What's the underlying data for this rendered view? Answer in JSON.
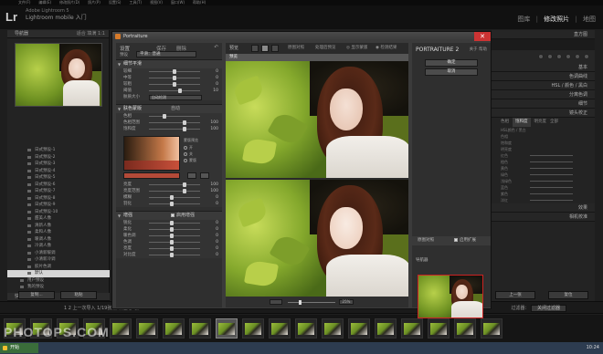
{
  "app": {
    "logo": "Lr",
    "title_small": "Adobe Lightroom 5",
    "title": "Lightroom mobile 入门",
    "menu": [
      "文件(F)",
      "编辑(E)",
      "修改照片(D)",
      "照片(P)",
      "设置(S)",
      "工具(T)",
      "视图(V)",
      "窗口(W)",
      "帮助(H)"
    ],
    "modules": [
      {
        "label": "图库",
        "active": false
      },
      {
        "label": "修改照片",
        "active": true
      },
      {
        "label": "地图",
        "active": false
      }
    ]
  },
  "left_panel": {
    "navigator_label": "导航器",
    "navigator_options": "适合  填满  1:1",
    "presets": [
      {
        "label": "日式预设-1"
      },
      {
        "label": "日式预设-2"
      },
      {
        "label": "日式预设-3"
      },
      {
        "label": "日式预设-4"
      },
      {
        "label": "日式预设-5"
      },
      {
        "label": "日式预设-6"
      },
      {
        "label": "日式预设-7"
      },
      {
        "label": "日式预设-8"
      },
      {
        "label": "日式预设-9"
      },
      {
        "label": "日式预设-10"
      },
      {
        "label": "甜美人像"
      },
      {
        "label": "清新人像"
      },
      {
        "label": "柔和人像"
      },
      {
        "label": "暖调人像"
      },
      {
        "label": "冷调人像"
      },
      {
        "label": "小清新暖调"
      },
      {
        "label": "小清新冷调"
      },
      {
        "label": "胶片色调"
      },
      {
        "label": "默认",
        "selected": true
      },
      {
        "label": "用户预设",
        "folder": true
      },
      {
        "label": "我的预设",
        "folder": true
      }
    ],
    "snapshots_label": "快照",
    "copy_button": "复制...",
    "paste_button": "粘贴"
  },
  "portraiture": {
    "window_title": "Portraiture",
    "close_glyph": "✕",
    "top": {
      "settings": "设置",
      "save": "保存",
      "delete": "删除",
      "undo": "↶",
      "preset_label": "预设",
      "preset_value": "平滑：普通"
    },
    "smoothing": {
      "header": "细节平滑",
      "sliders": [
        {
          "label": "较细",
          "value": "0",
          "knob_pct": 50
        },
        {
          "label": "中等",
          "value": "0",
          "knob_pct": 50
        },
        {
          "label": "较粗",
          "value": "0",
          "knob_pct": 50
        },
        {
          "label": "阈值",
          "value": "10",
          "knob_pct": 60
        }
      ],
      "size_label": "肤质大小",
      "size_value": "自动检测"
    },
    "mask": {
      "header": "肤色蒙版",
      "mode": "自动",
      "sliders": [
        {
          "label": "色相",
          "value": "",
          "knob_pct": 30
        },
        {
          "label": "色相范围",
          "value": "100",
          "knob_pct": 70
        },
        {
          "label": "饱和度",
          "value": "100",
          "knob_pct": 70
        }
      ],
      "options_title": "蒙版预览",
      "options": [
        "开",
        "关",
        "蒙版"
      ],
      "extra_sliders": [
        {
          "label": "亮度",
          "value": "100",
          "knob_pct": 70
        },
        {
          "label": "亮度范围",
          "value": "100",
          "knob_pct": 70
        },
        {
          "label": "模糊",
          "value": "0",
          "knob_pct": 45
        },
        {
          "label": "羽化",
          "value": "0",
          "knob_pct": 45
        }
      ]
    },
    "enhance": {
      "header": "增强",
      "check_label": "启用增强",
      "sliders": [
        {
          "label": "锐化",
          "value": "0",
          "knob_pct": 45
        },
        {
          "label": "柔化",
          "value": "0",
          "knob_pct": 45
        },
        {
          "label": "暖色调",
          "value": "0",
          "knob_pct": 45
        },
        {
          "label": "色调",
          "value": "0",
          "knob_pct": 45
        },
        {
          "label": "亮度",
          "value": "0",
          "knob_pct": 45
        },
        {
          "label": "对比度",
          "value": "0",
          "knob_pct": 45
        }
      ]
    },
    "toolbar": {
      "label": "预览",
      "opt1": "原图对照",
      "opt2": "处理后预览",
      "opt3": "◎ 显示蒙版",
      "opt4": "◉ 检测结果"
    },
    "tab_label": "预览",
    "zoom": {
      "value": "25%",
      "fit": "适合"
    },
    "brand": "PORTRAITURE 2",
    "about": "关于",
    "help": "帮助",
    "ok_button": "确定",
    "cancel_button": "取消",
    "before_after_label": "原图对照",
    "before_after_check": "启用扩展",
    "navigator_label": "导航器"
  },
  "right_panel": {
    "histogram_label": "直方图",
    "sections": [
      "基本",
      "色调曲线",
      "HSL / 颜色 / 黑白",
      "分离色调",
      "细节",
      "镜头校正"
    ],
    "hsl_tabs": [
      "色相",
      "饱和度",
      "明亮度",
      "全部"
    ],
    "rows": [
      "HSL颜色 / 黑白",
      "色相",
      "饱和度",
      "明亮度"
    ],
    "sliders": [
      "红色",
      "橙色",
      "黄色",
      "绿色",
      "浅绿色",
      "蓝色",
      "紫色",
      "洋红"
    ],
    "bottom_sections": [
      "效果",
      "相机校准"
    ],
    "prev_button": "上一张",
    "reset_button": "复位"
  },
  "filmstrip": {
    "info": "1  2  上一次导入  1/19张照片/选定1张",
    "filter_label": "过滤器：",
    "filter_value": "关闭过滤器",
    "thumb_count": 19,
    "selected_index": 8
  },
  "taskbar": {
    "start": "开始",
    "tray": "10:24"
  },
  "watermark": "PHOTOPS.COM"
}
